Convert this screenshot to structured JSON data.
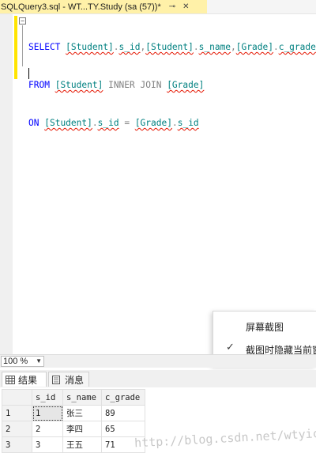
{
  "document_tab": {
    "title": "SQLQuery3.sql - WT...TY.Study (sa (57))*",
    "pin_glyph": "⊸",
    "close_glyph": "✕"
  },
  "editor": {
    "lines": [
      [
        "SELECT",
        "[Student]",
        ".",
        "s_id",
        ",",
        "[Student]",
        ".",
        "s_name",
        ",",
        "[Grade]",
        ".",
        "c_grade"
      ],
      [
        "FROM",
        "[Student]",
        "INNER JOIN",
        "[Grade]"
      ],
      [
        "ON",
        "[Student]",
        ".",
        "s_id",
        "=",
        "[Grade]",
        ".",
        "s_id"
      ]
    ]
  },
  "toast": {
    "title": "屏幕截图",
    "option": "截图时隐藏当前窗口"
  },
  "zoom": {
    "value": "100 %"
  },
  "results_tabs": [
    {
      "label": "结果",
      "active": true
    },
    {
      "label": "消息",
      "active": false
    }
  ],
  "grid": {
    "columns": [
      "s_id",
      "s_name",
      "c_grade"
    ],
    "rows": [
      {
        "num": "1",
        "cells": [
          "1",
          "张三",
          "89"
        ]
      },
      {
        "num": "2",
        "cells": [
          "2",
          "李四",
          "65"
        ]
      },
      {
        "num": "3",
        "cells": [
          "3",
          "王五",
          "71"
        ]
      }
    ]
  },
  "watermark": "http://blog.csdn.net/wtyicy",
  "colors": {
    "keyword": "#0000ff",
    "identifier": "#008080",
    "tab_active": "#fff1a8",
    "change_bar": "#ffe400"
  }
}
